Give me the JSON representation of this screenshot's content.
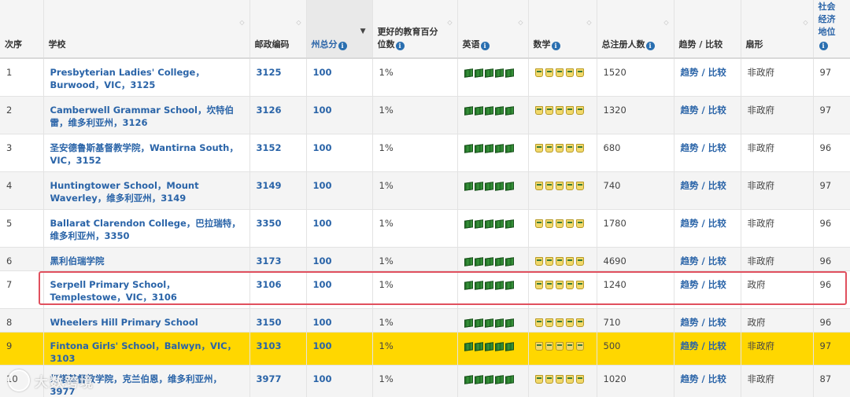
{
  "headers": {
    "rank": "次序",
    "school": "学校",
    "postcode": "邮政编码",
    "state_score": "州总分",
    "better_edu_line1": "更好的教育百分",
    "better_edu_line2": "位数",
    "english": "英语",
    "math": "数学",
    "enrolment": "总注册人数",
    "trend": "趋势 / 比较",
    "sector": "扇形",
    "ses_line1": "社会",
    "ses_line2": "经济",
    "ses_line3": "地位"
  },
  "info_glyph": "i",
  "rows": [
    {
      "rank": "1",
      "school": "Presbyterian Ladies' College，Burwood，VIC，3125",
      "postcode": "3125",
      "score": "100",
      "percentile": "1%",
      "english": 5,
      "math": 5,
      "enrolment": "1520",
      "trend": "趋势 / 比较",
      "sector": "非政府",
      "ses": "97"
    },
    {
      "rank": "2",
      "school": "Camberwell Grammar School，坎特伯雷，维多利亚州，3126",
      "postcode": "3126",
      "score": "100",
      "percentile": "1%",
      "english": 5,
      "math": 5,
      "enrolment": "1320",
      "trend": "趋势 / 比较",
      "sector": "非政府",
      "ses": "97"
    },
    {
      "rank": "3",
      "school": "圣安德鲁斯基督教学院，Wantirna South，VIC，3152",
      "postcode": "3152",
      "score": "100",
      "percentile": "1%",
      "english": 5,
      "math": 5,
      "enrolment": "680",
      "trend": "趋势 / 比较",
      "sector": "非政府",
      "ses": "96"
    },
    {
      "rank": "4",
      "school": "Huntingtower School，Mount Waverley，维多利亚州，3149",
      "postcode": "3149",
      "score": "100",
      "percentile": "1%",
      "english": 5,
      "math": 5,
      "enrolment": "740",
      "trend": "趋势 / 比较",
      "sector": "非政府",
      "ses": "97"
    },
    {
      "rank": "5",
      "school": "Ballarat Clarendon College，巴拉瑞特，维多利亚州，3350",
      "postcode": "3350",
      "score": "100",
      "percentile": "1%",
      "english": 5,
      "math": 5,
      "enrolment": "1780",
      "trend": "趋势 / 比较",
      "sector": "非政府",
      "ses": "96"
    },
    {
      "rank": "6",
      "school": "黑利伯瑞学院",
      "postcode": "3173",
      "score": "100",
      "percentile": "1%",
      "english": 5,
      "math": 5,
      "enrolment": "4690",
      "trend": "趋势 / 比较",
      "sector": "非政府",
      "ses": "96"
    },
    {
      "rank": "7",
      "school": "Serpell Primary School，Templestowe，VIC，3106",
      "postcode": "3106",
      "score": "100",
      "percentile": "1%",
      "english": 5,
      "math": 5,
      "enrolment": "1240",
      "trend": "趋势 / 比较",
      "sector": "政府",
      "ses": "96"
    },
    {
      "rank": "8",
      "school": "Wheelers Hill Primary School",
      "postcode": "3150",
      "score": "100",
      "percentile": "1%",
      "english": 5,
      "math": 5,
      "enrolment": "710",
      "trend": "趋势 / 比较",
      "sector": "政府",
      "ses": "96"
    },
    {
      "rank": "9",
      "school": "Fintona Girls' School，Balwyn，VIC，3103",
      "postcode": "3103",
      "score": "100",
      "percentile": "1%",
      "english": 5,
      "math": 5,
      "enrolment": "500",
      "trend": "趋势 / 比较",
      "sector": "非政府",
      "ses": "97"
    },
    {
      "rank": "10",
      "school": "灯塔基督教学院，克兰伯恩，维多利亚州，3977",
      "postcode": "3977",
      "score": "100",
      "percentile": "1%",
      "english": 5,
      "math": 5,
      "enrolment": "1020",
      "trend": "趋势 / 比较",
      "sector": "非政府",
      "ses": "87"
    }
  ],
  "watermark": "大数跨境",
  "colors": {
    "link": "#2a64a8",
    "highlight_row": "#ffd700",
    "callout_border": "#e0505e",
    "header_bg": "#f5f5f5",
    "alt_row": "#f4f4f4"
  }
}
